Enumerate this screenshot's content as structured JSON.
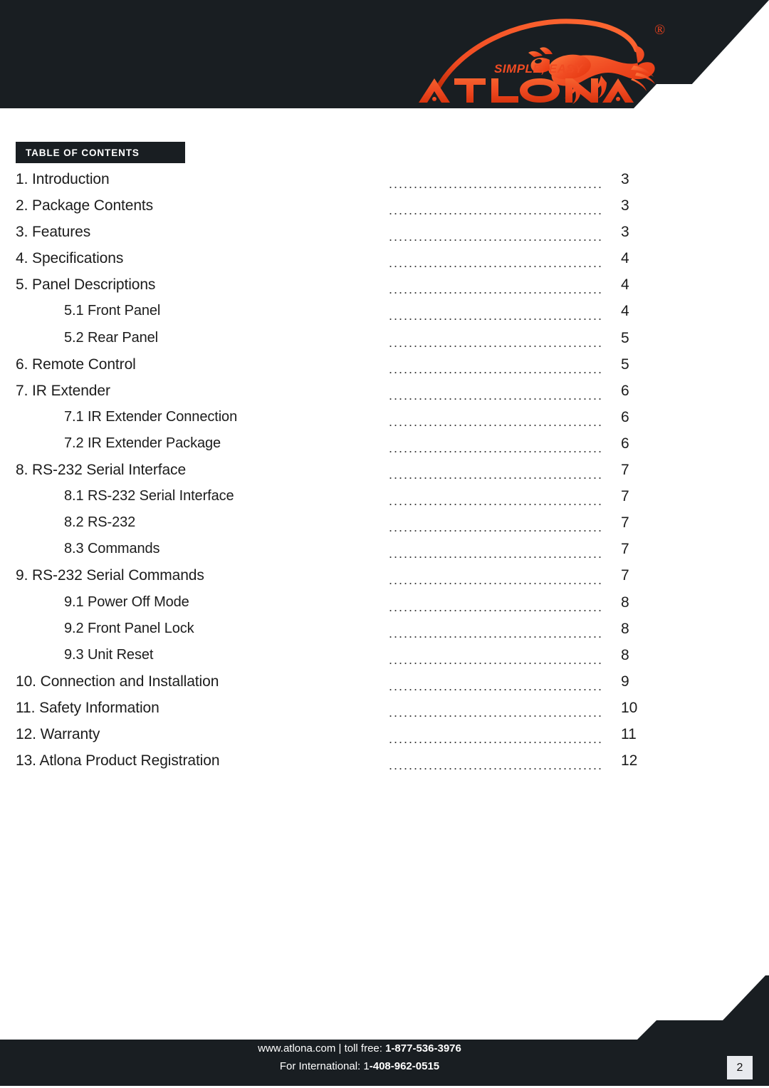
{
  "brand": {
    "logo_wordmark": "ATLONA",
    "tagline": "SIMPLE, EASY",
    "registered_mark": "®",
    "accent_color": "#f04b22",
    "dark_color": "#191e22"
  },
  "section_header": {
    "label": "TABLE OF CONTENTS"
  },
  "toc": {
    "entries": [
      {
        "label": "1. Introduction",
        "page": "3",
        "level": 1
      },
      {
        "label": "2. Package Contents",
        "page": "3",
        "level": 1
      },
      {
        "label": "3. Features",
        "page": "3",
        "level": 1
      },
      {
        "label": "4. Specifications",
        "page": "4",
        "level": 1
      },
      {
        "label": "5. Panel Descriptions",
        "page": "4",
        "level": 1
      },
      {
        "label": "5.1 Front Panel",
        "page": "4",
        "level": 2
      },
      {
        "label": "5.2 Rear Panel",
        "page": "5",
        "level": 2
      },
      {
        "label": "6. Remote Control",
        "page": "5",
        "level": 1
      },
      {
        "label": "7. IR Extender",
        "page": "6",
        "level": 1
      },
      {
        "label": "7.1 IR Extender Connection",
        "page": "6",
        "level": 2
      },
      {
        "label": "7.2 IR Extender Package",
        "page": "6",
        "level": 2
      },
      {
        "label": "8. RS-232 Serial Interface",
        "page": "7",
        "level": 1
      },
      {
        "label": "8.1 RS-232 Serial Interface",
        "page": "7",
        "level": 2
      },
      {
        "label": "8.2 RS-232",
        "page": "7",
        "level": 2
      },
      {
        "label": "8.3 Commands",
        "page": "7",
        "level": 2
      },
      {
        "label": "9. RS-232 Serial Commands",
        "page": "7",
        "level": 1
      },
      {
        "label": "9.1 Power Off Mode",
        "page": "8",
        "level": 2
      },
      {
        "label": "9.2 Front Panel Lock",
        "page": "8",
        "level": 2
      },
      {
        "label": "9.3 Unit Reset",
        "page": "8",
        "level": 2
      },
      {
        "label": "10. Connection and Installation",
        "page": "9",
        "level": 1
      },
      {
        "label": "11. Safety Information",
        "page": "10",
        "level": 1
      },
      {
        "label": "12. Warranty",
        "page": "11",
        "level": 1
      },
      {
        "label": "13. Atlona Product Registration",
        "page": "12",
        "level": 1
      }
    ],
    "leader": "......................................................."
  },
  "footer": {
    "line1_prefix": "www.atlona.com | toll free: ",
    "line1_phone": "1-877-536-3976",
    "line2_prefix": "For International: 1",
    "line2_phone": "-408-962-0515",
    "page_number": "2"
  }
}
